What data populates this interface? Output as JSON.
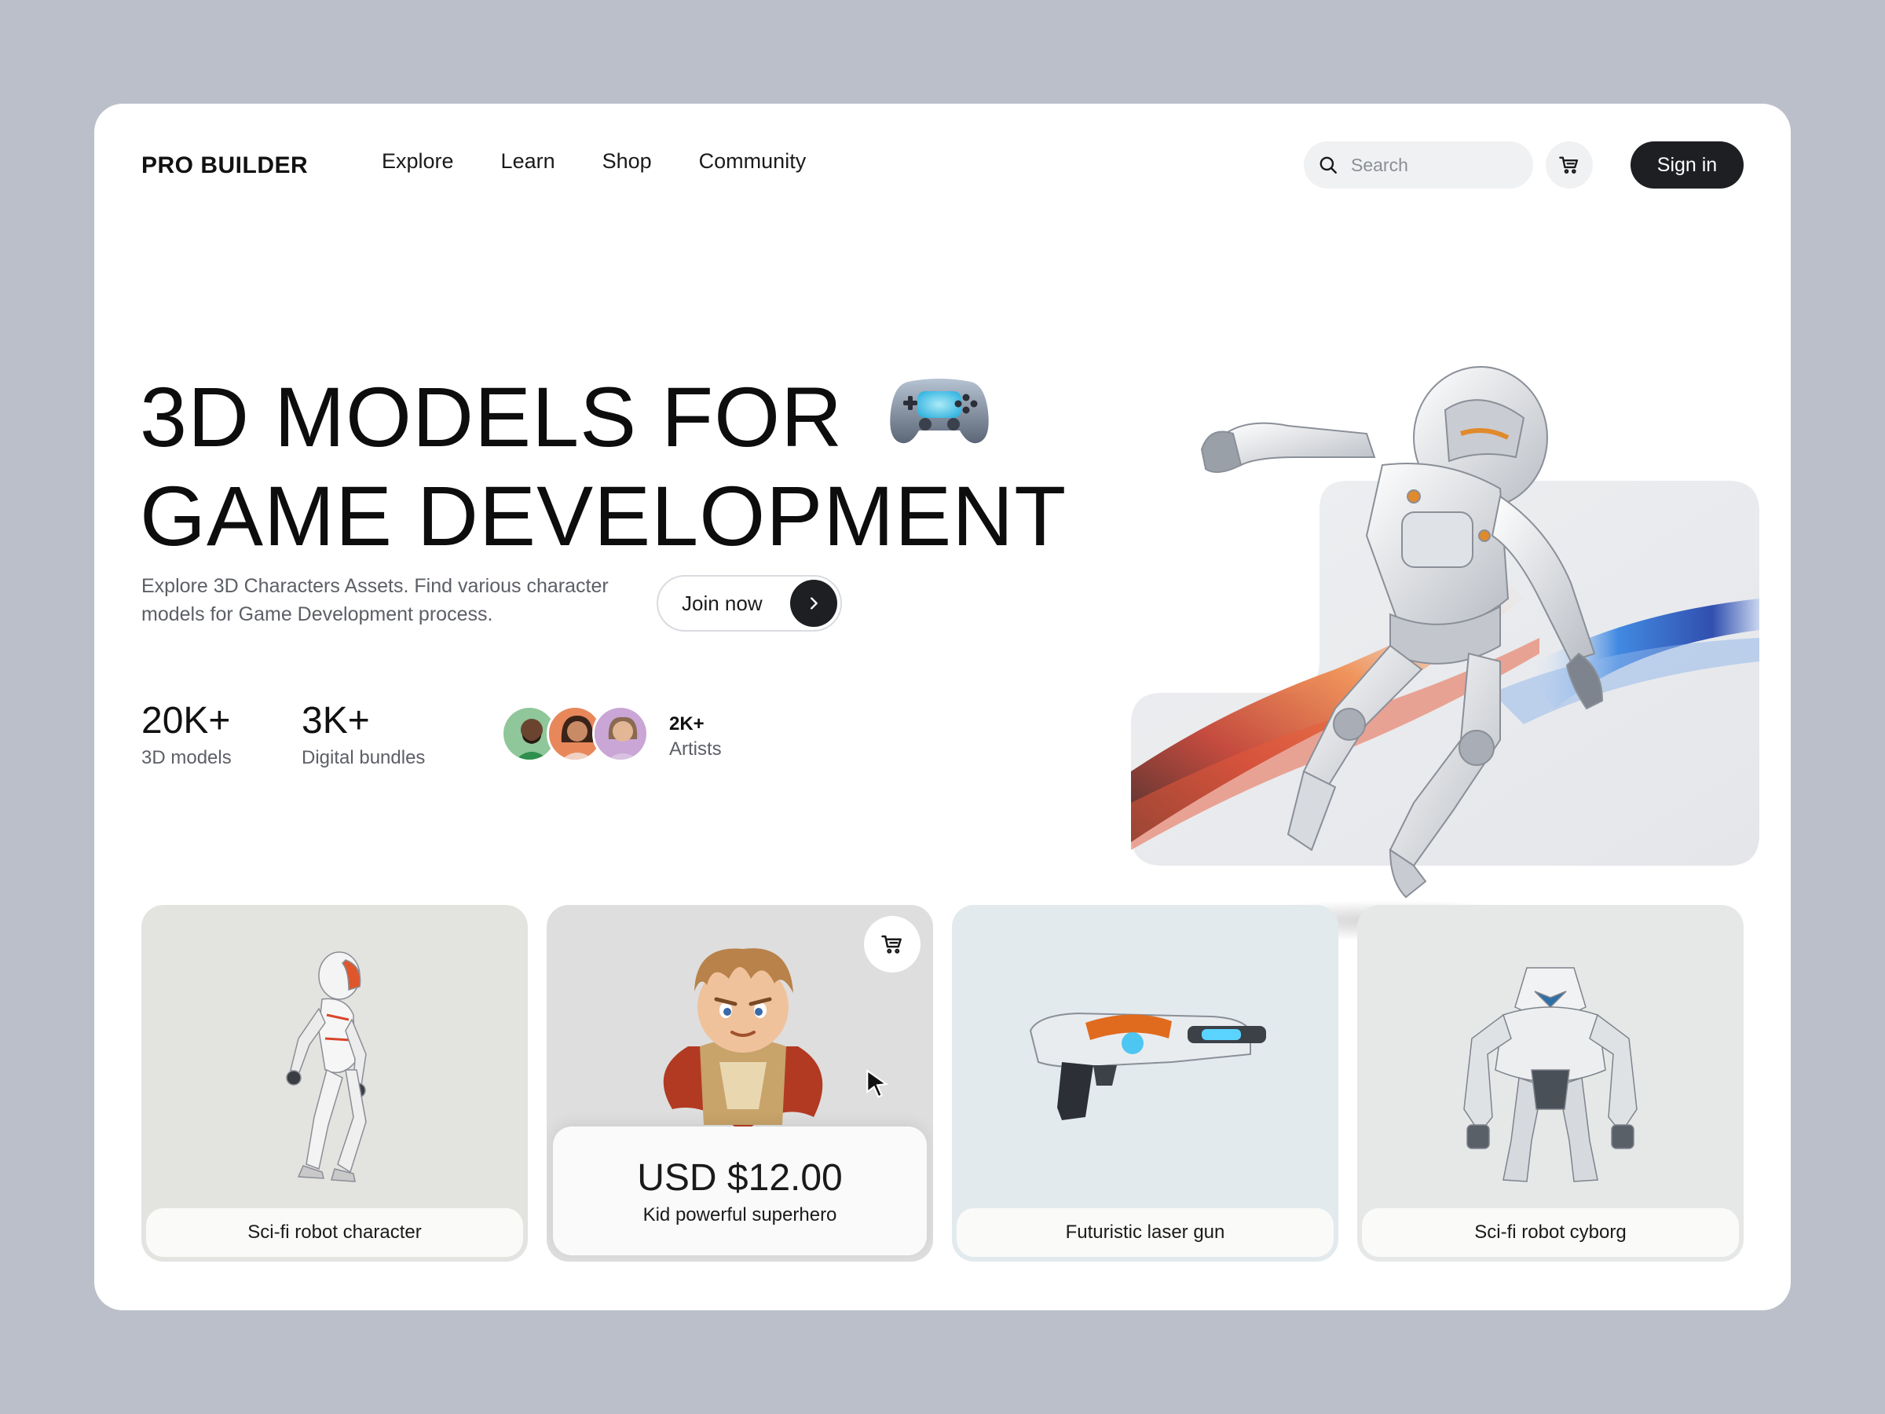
{
  "brand": {
    "name": "PRO BUILDER"
  },
  "nav": {
    "items": [
      "Explore",
      "Learn",
      "Shop",
      "Community"
    ]
  },
  "search": {
    "placeholder": "Search"
  },
  "header": {
    "signin_label": "Sign in"
  },
  "hero": {
    "title_line1": "3D MODELS FOR",
    "title_line2": "GAME DEVELOPMENT",
    "subtitle": "Explore 3D Characters Assets. Find various character models for Game Development process.",
    "cta_label": "Join now"
  },
  "stats": [
    {
      "value": "20K+",
      "label": "3D models"
    },
    {
      "value": "3K+",
      "label": "Digital bundles"
    }
  ],
  "artists": {
    "value": "2K+",
    "label": "Artists"
  },
  "cards": [
    {
      "label": "Sci-fi robot character",
      "bg": "#e3e3e0"
    },
    {
      "label": "Kid powerful superhero",
      "price": "USD $12.00",
      "bg": "#dedede"
    },
    {
      "label": "Futuristic laser gun",
      "bg": "#e2eaed"
    },
    {
      "label": "Sci-fi robot cyborg",
      "bg": "#e6e8e8"
    }
  ],
  "colors": {
    "page_bg": "#bbbfca",
    "accent_dark": "#1e1f22",
    "muted_text": "#5c5f66"
  }
}
